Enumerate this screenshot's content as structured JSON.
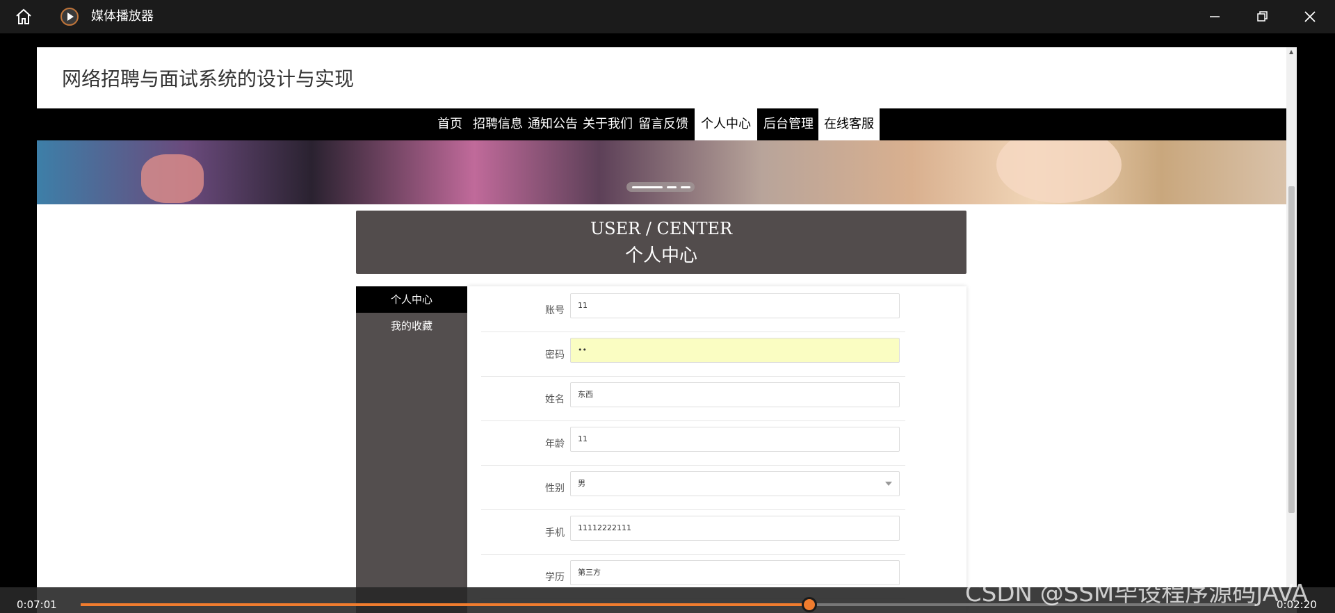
{
  "player": {
    "title": "媒体播放器",
    "time_elapsed": "0:07:01",
    "time_remaining": "0:02:20",
    "progress": 0.62,
    "watermark": "CSDN @SSM毕设程序源码JAVA",
    "accent_color": "#f07c2e"
  },
  "site": {
    "title": "网络招聘与面试系统的设计与实现",
    "nav": [
      {
        "label": "首页",
        "active": false
      },
      {
        "label": "招聘信息",
        "active": false
      },
      {
        "label": "通知公告",
        "active": false
      },
      {
        "label": "关于我们",
        "active": false
      },
      {
        "label": "留言反馈",
        "active": false
      },
      {
        "label": "个人中心",
        "active": true
      },
      {
        "label": "后台管理",
        "active": false
      },
      {
        "label": "在线客服",
        "active": true
      }
    ]
  },
  "user_center": {
    "heading_en": "USER / CENTER",
    "heading_zh": "个人中心",
    "side_menu": [
      {
        "label": "个人中心",
        "active": true
      },
      {
        "label": "我的收藏",
        "active": false
      }
    ],
    "form": [
      {
        "label": "账号",
        "value": "11"
      },
      {
        "label": "密码",
        "value": "••"
      },
      {
        "label": "姓名",
        "value": "东西"
      },
      {
        "label": "年龄",
        "value": "11"
      },
      {
        "label": "性别",
        "value": "男"
      },
      {
        "label": "手机",
        "value": "11112222111"
      },
      {
        "label": "学历",
        "value": "第三方"
      }
    ]
  }
}
